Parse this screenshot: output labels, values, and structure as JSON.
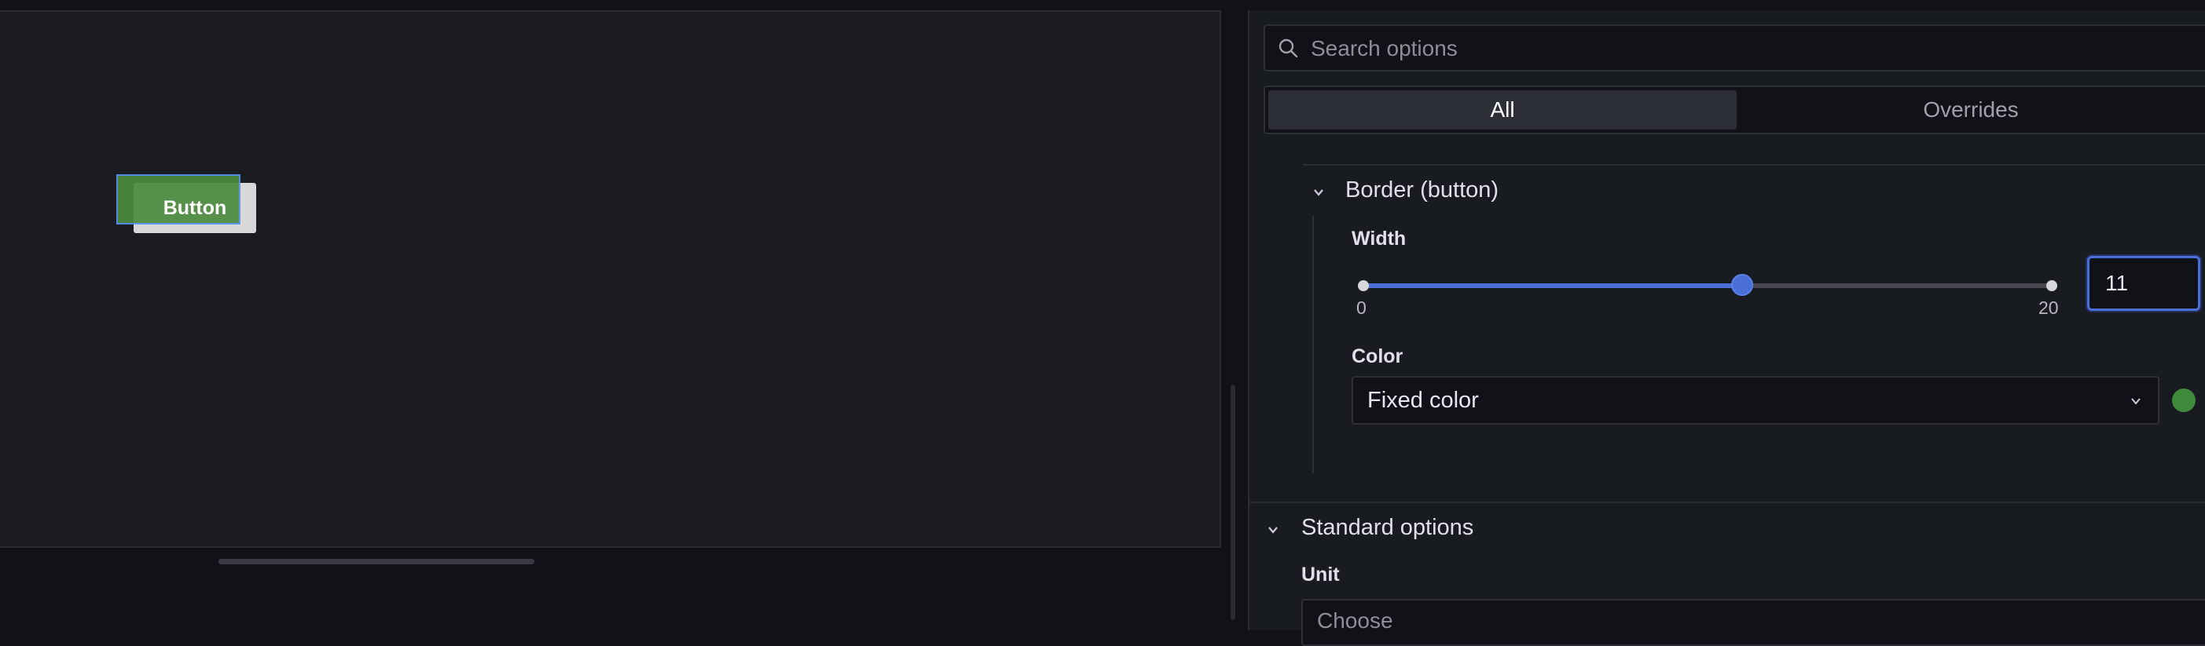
{
  "canvas": {
    "element_label": "Button",
    "element_colors": {
      "background": "#d8d8d8",
      "border": "#4b8a3e",
      "selection": "#5794f2"
    }
  },
  "options": {
    "search": {
      "placeholder": "Search options",
      "value": ""
    },
    "tabs": [
      {
        "label": "All",
        "active": true
      },
      {
        "label": "Overrides",
        "active": false
      }
    ],
    "border_section": {
      "title": "Border (button)",
      "expanded": true,
      "width": {
        "label": "Width",
        "value": "11",
        "min_label": "0",
        "max_label": "20",
        "fraction": 0.55
      },
      "color": {
        "label": "Color",
        "mode": "Fixed color",
        "swatch": "#3f8a3a"
      }
    },
    "standard_section": {
      "title": "Standard options",
      "expanded": true,
      "unit_label": "Unit",
      "unit_placeholder": "Choose"
    },
    "accent_color": "#4a6fd6"
  }
}
